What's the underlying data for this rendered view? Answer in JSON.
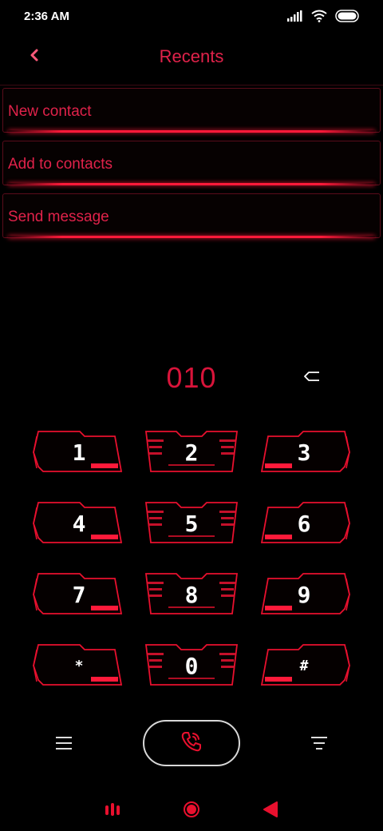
{
  "status": {
    "time": "2:36 AM",
    "icons": [
      "signal-icon",
      "wifi-icon",
      "battery-icon"
    ]
  },
  "header": {
    "title": "Recents",
    "back_icon": "chevron-left-icon"
  },
  "menu": [
    {
      "label": "New contact"
    },
    {
      "label": "Add to contacts"
    },
    {
      "label": "Send message"
    }
  ],
  "dialer": {
    "number": "010",
    "backspace_icon": "backspace-icon"
  },
  "keypad": {
    "keys": [
      {
        "label": "1"
      },
      {
        "label": "2"
      },
      {
        "label": "3"
      },
      {
        "label": "4"
      },
      {
        "label": "5"
      },
      {
        "label": "6"
      },
      {
        "label": "7"
      },
      {
        "label": "8"
      },
      {
        "label": "9"
      },
      {
        "label": "*"
      },
      {
        "label": "0"
      },
      {
        "label": "#"
      }
    ]
  },
  "actions": {
    "menu_icon": "menu-lines-icon",
    "call_icon": "phone-call-icon",
    "filter_icon": "filter-icon"
  },
  "nav": {
    "recents_icon": "recent-apps-icon",
    "home_icon": "home-icon",
    "back_icon": "back-triangle-icon"
  },
  "colors": {
    "accent": "#e0224a",
    "background": "#000000",
    "keypad_outline": "#e8102e"
  }
}
